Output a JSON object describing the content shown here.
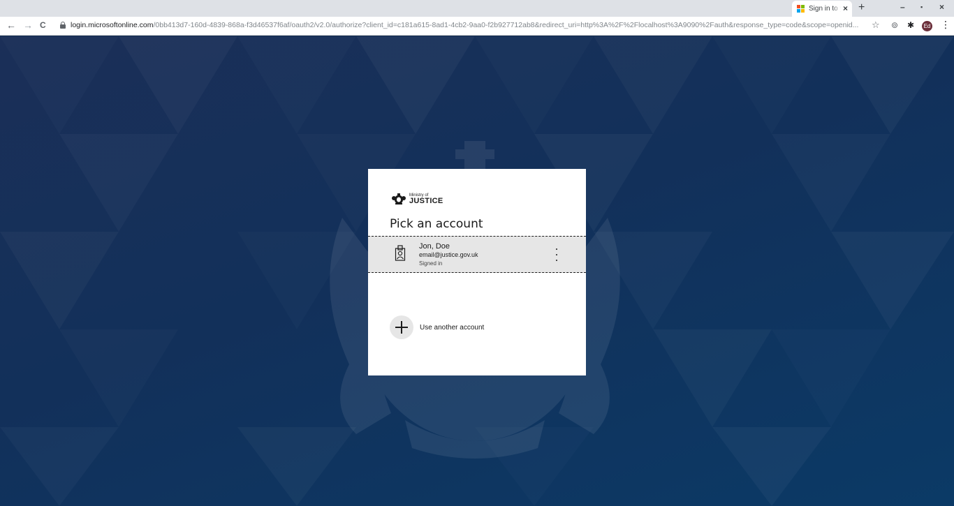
{
  "browser": {
    "tab_title": "Sign in to your account",
    "new_tab": "+",
    "close_tab": "×",
    "window": {
      "minimize": "–",
      "maximize": "▪",
      "close": "×"
    },
    "url_domain": "login.microsoftonline.com",
    "url_path": "/0bb413d7-160d-4839-868a-f3d46537f6af/oauth2/v2.0/authorize?client_id=c181a615-8ad1-4cb2-9aa0-f2b927712ab8&redirect_uri=http%3A%2F%2Flocalhost%3A9090%2Fauth&response_type=code&scope=openid...",
    "profile_initials": "Ed",
    "nav": {
      "back": "←",
      "forward": "→",
      "reload": "C"
    },
    "icons": {
      "bookmark": "☆",
      "extension": "⊚",
      "puzzle": "✱",
      "menu": "⋮"
    }
  },
  "card": {
    "logo_small": "Ministry of",
    "logo_big": "JUSTICE",
    "heading": "Pick an account",
    "account": {
      "name": "Jon, Doe",
      "email": "email@justice.gov.uk",
      "status": "Signed in"
    },
    "another_account_label": "Use another account"
  }
}
